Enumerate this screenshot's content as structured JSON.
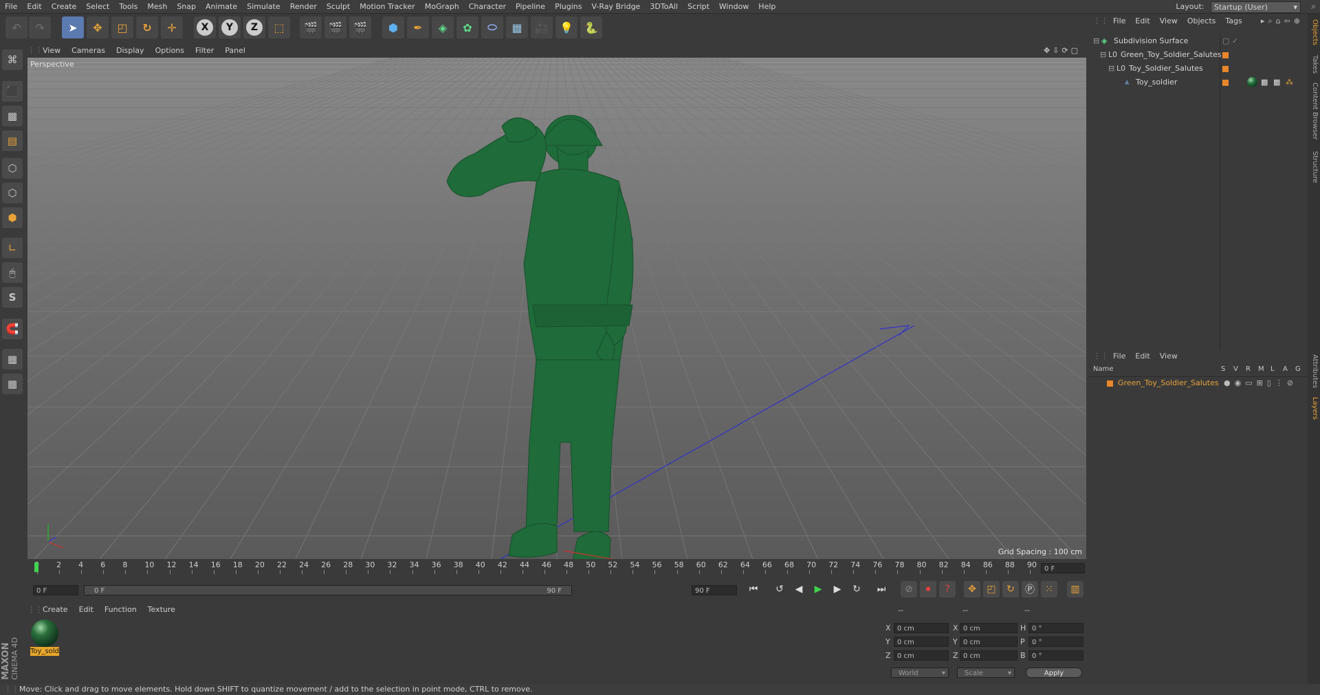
{
  "menubar": {
    "items": [
      "File",
      "Edit",
      "Create",
      "Select",
      "Tools",
      "Mesh",
      "Snap",
      "Animate",
      "Simulate",
      "Render",
      "Sculpt",
      "Motion Tracker",
      "MoGraph",
      "Character",
      "Pipeline",
      "Plugins",
      "V-Ray Bridge",
      "3DToAll",
      "Script",
      "Window",
      "Help"
    ],
    "layout_label": "Layout:",
    "layout_value": "Startup (User)"
  },
  "viewport": {
    "menu": [
      "View",
      "Cameras",
      "Display",
      "Options",
      "Filter",
      "Panel"
    ],
    "label": "Perspective",
    "grid_spacing": "Grid Spacing : 100 cm"
  },
  "timeline": {
    "ticks": [
      "0",
      "2",
      "4",
      "6",
      "8",
      "10",
      "12",
      "14",
      "16",
      "18",
      "20",
      "22",
      "24",
      "26",
      "28",
      "30",
      "32",
      "34",
      "36",
      "38",
      "40",
      "42",
      "44",
      "46",
      "48",
      "50",
      "52",
      "54",
      "56",
      "58",
      "60",
      "62",
      "64",
      "66",
      "68",
      "70",
      "72",
      "74",
      "76",
      "78",
      "80",
      "82",
      "84",
      "86",
      "88",
      "90"
    ],
    "current_frame": "0 F",
    "start_field": "0 F",
    "range_start": "0 F",
    "range_end": "90 F",
    "end_field": "90 F"
  },
  "material": {
    "menu": [
      "Create",
      "Edit",
      "Function",
      "Texture"
    ],
    "items": [
      {
        "name": "Toy_sold"
      }
    ]
  },
  "coords": {
    "header": [
      "--",
      "--",
      "--"
    ],
    "rows": [
      {
        "a": "X",
        "av": "0 cm",
        "b": "X",
        "bv": "0 cm",
        "c": "H",
        "cv": "0 °"
      },
      {
        "a": "Y",
        "av": "0 cm",
        "b": "Y",
        "bv": "0 cm",
        "c": "P",
        "cv": "0 °"
      },
      {
        "a": "Z",
        "av": "0 cm",
        "b": "Z",
        "bv": "0 cm",
        "c": "B",
        "cv": "0 °"
      }
    ],
    "mode1": "World",
    "mode2": "Scale",
    "apply": "Apply"
  },
  "objects": {
    "menu": [
      "File",
      "Edit",
      "View",
      "Objects",
      "Tags"
    ],
    "items": [
      {
        "name": "Subdivision Surface",
        "depth": 0
      },
      {
        "name": "Green_Toy_Soldier_Salutes",
        "depth": 1
      },
      {
        "name": "Toy_Soldier_Salutes",
        "depth": 2
      },
      {
        "name": "Toy_soldier",
        "depth": 3
      }
    ]
  },
  "layers": {
    "menu": [
      "File",
      "Edit",
      "View"
    ],
    "columns": [
      "Name",
      "S",
      "V",
      "R",
      "M",
      "L",
      "A",
      "G"
    ],
    "items": [
      {
        "name": "Green_Toy_Soldier_Salutes"
      }
    ]
  },
  "right_tabs": [
    "Objects",
    "Takes",
    "Content Browser",
    "Structure",
    "Attributes",
    "Layers"
  ],
  "status": "Move: Click and drag to move elements. Hold down SHIFT to quantize movement / add to the selection in point mode, CTRL to remove.",
  "brand": {
    "line1": "MAXON",
    "line2": "CINEMA 4D"
  },
  "colors": {
    "accent": "#e8862a",
    "soldier": "#1f6b3a",
    "selected": "#5b7ab0"
  }
}
